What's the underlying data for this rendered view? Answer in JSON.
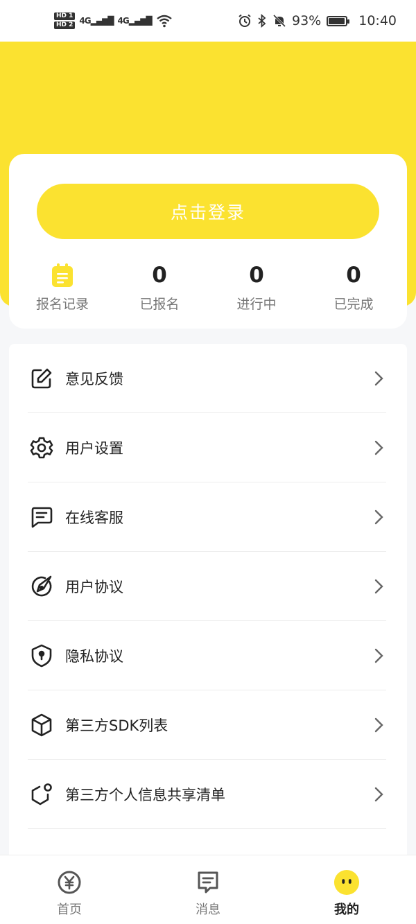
{
  "status_bar": {
    "hd1": "HD 1",
    "hd2": "HD 2",
    "net1": "4G",
    "net2": "4G",
    "battery": "93%",
    "battery_level": 0.93,
    "time": "10:40"
  },
  "login": {
    "button_label": "点击登录"
  },
  "stats": [
    {
      "label": "报名记录",
      "icon": "clipboard-icon"
    },
    {
      "value": "0",
      "label": "已报名"
    },
    {
      "value": "0",
      "label": "进行中"
    },
    {
      "value": "0",
      "label": "已完成"
    }
  ],
  "menu": [
    {
      "label": "意见反馈",
      "icon": "edit-icon"
    },
    {
      "label": "用户设置",
      "icon": "gear-icon"
    },
    {
      "label": "在线客服",
      "icon": "chat-icon"
    },
    {
      "label": "用户协议",
      "icon": "compass-icon"
    },
    {
      "label": "隐私协议",
      "icon": "shield-icon"
    },
    {
      "label": "第三方SDK列表",
      "icon": "cube-icon"
    },
    {
      "label": "第三方个人信息共享清单",
      "icon": "share-hexagon-icon"
    }
  ],
  "tabs": [
    {
      "label": "首页",
      "icon": "yuan-icon",
      "active": false
    },
    {
      "label": "消息",
      "icon": "message-icon",
      "active": false
    },
    {
      "label": "我的",
      "icon": "face-icon",
      "active": true
    }
  ],
  "colors": {
    "accent": "#fbe230",
    "text": "#222222",
    "muted": "#777777"
  }
}
